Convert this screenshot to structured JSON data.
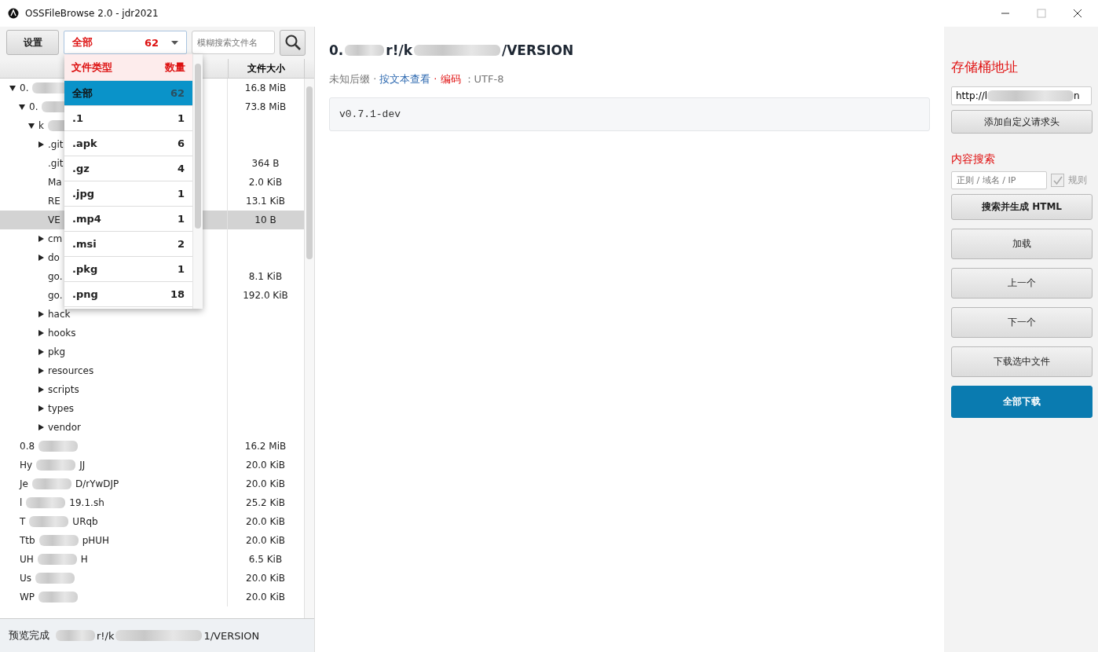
{
  "window": {
    "title": "OSSFileBrowse 2.0 - jdr2021"
  },
  "toolbar": {
    "settings_button": "设置",
    "type_select": {
      "label": "全部",
      "count": "62",
      "expanded": true
    },
    "search": {
      "placeholder": "模糊搜索文件名"
    }
  },
  "type_menu": {
    "header": {
      "type": "文件类型",
      "count": "数量"
    },
    "options": [
      {
        "label": "全部",
        "count": "62",
        "selected": true
      },
      {
        "label": ".1",
        "count": "1",
        "selected": false
      },
      {
        "label": ".apk",
        "count": "6",
        "selected": false
      },
      {
        "label": ".gz",
        "count": "4",
        "selected": false
      },
      {
        "label": ".jpg",
        "count": "1",
        "selected": false
      },
      {
        "label": ".mp4",
        "count": "1",
        "selected": false
      },
      {
        "label": ".msi",
        "count": "2",
        "selected": false
      },
      {
        "label": ".pkg",
        "count": "1",
        "selected": false
      },
      {
        "label": ".png",
        "count": "18",
        "selected": false
      }
    ]
  },
  "table": {
    "columns": [
      "文件大小"
    ],
    "rows": [
      {
        "parts": [
          "0."
        ],
        "redacted": true,
        "expanded": true,
        "size": "16.8 MiB",
        "selected": false,
        "children": [
          {
            "parts": [
              "0."
            ],
            "redacted": true,
            "expanded": true,
            "size": "73.8 MiB",
            "selected": false,
            "children": [
              {
                "parts": [
                  "k"
                ],
                "redacted": true,
                "expanded": true,
                "selected": false,
                "children": [
                  {
                    "parts": [
                      ".git"
                    ],
                    "expanded": false,
                    "selected": false
                  },
                  {
                    "parts": [
                      ".git"
                    ],
                    "size": "364 B",
                    "selected": false
                  },
                  {
                    "parts": [
                      "Ma"
                    ],
                    "size": "2.0 KiB",
                    "selected": false
                  },
                  {
                    "parts": [
                      "RE"
                    ],
                    "size": "13.1 KiB",
                    "selected": false
                  },
                  {
                    "parts": [
                      "VE"
                    ],
                    "size": "10 B",
                    "selected": true
                  },
                  {
                    "parts": [
                      "cm"
                    ],
                    "expanded": false,
                    "selected": false
                  },
                  {
                    "parts": [
                      "do"
                    ],
                    "expanded": false,
                    "selected": false
                  },
                  {
                    "parts": [
                      "go."
                    ],
                    "size": "8.1 KiB",
                    "selected": false
                  },
                  {
                    "parts": [
                      "go."
                    ],
                    "size": "192.0 KiB",
                    "selected": false
                  },
                  {
                    "parts": [
                      "hack"
                    ],
                    "redacted": false,
                    "expanded": false,
                    "selected": false
                  },
                  {
                    "parts": [
                      "hooks"
                    ],
                    "redacted": false,
                    "expanded": false,
                    "selected": false
                  },
                  {
                    "parts": [
                      "pkg"
                    ],
                    "redacted": false,
                    "expanded": false,
                    "selected": false
                  },
                  {
                    "parts": [
                      "resources"
                    ],
                    "redacted": false,
                    "expanded": false,
                    "selected": false
                  },
                  {
                    "parts": [
                      "scripts"
                    ],
                    "redacted": false,
                    "expanded": false,
                    "selected": false
                  },
                  {
                    "parts": [
                      "types"
                    ],
                    "redacted": false,
                    "expanded": false,
                    "selected": false
                  },
                  {
                    "parts": [
                      "vendor"
                    ],
                    "redacted": false,
                    "expanded": false,
                    "selected": false
                  }
                ]
              }
            ]
          }
        ]
      },
      {
        "parts": [
          "0.8"
        ],
        "redacted": true,
        "size": "16.2 MiB",
        "selected": false
      },
      {
        "parts": [
          "Hy",
          "JJ"
        ],
        "redacted": true,
        "size": "20.0 KiB",
        "selected": false
      },
      {
        "parts": [
          "Je",
          "D/rYwDJP"
        ],
        "redacted": true,
        "size": "20.0 KiB",
        "selected": false
      },
      {
        "parts": [
          "l",
          "19.1.sh"
        ],
        "redacted": true,
        "size": "25.2 KiB",
        "selected": false
      },
      {
        "parts": [
          "T",
          "URqb"
        ],
        "redacted": true,
        "size": "20.0 KiB",
        "selected": false
      },
      {
        "parts": [
          "Ttb",
          "pHUH"
        ],
        "redacted": true,
        "size": "20.0 KiB",
        "selected": false
      },
      {
        "parts": [
          "UH",
          "H"
        ],
        "redacted": true,
        "size": "6.5 KiB",
        "selected": false
      },
      {
        "parts": [
          "Us"
        ],
        "redacted": true,
        "size": "20.0 KiB",
        "selected": false
      },
      {
        "parts": [
          "WP"
        ],
        "redacted": true,
        "size": "20.0 KiB",
        "selected": false
      }
    ]
  },
  "status_bar": {
    "label": "预览完成",
    "path_parts": [
      "r!/k",
      "1/VERSION"
    ],
    "redacted": true
  },
  "preview": {
    "title_parts": [
      "0.",
      "r!/k",
      "/VERSION"
    ],
    "redacted": true,
    "meta": {
      "suffix": "未知后缀 ·",
      "view_mode": "按文本查看",
      "encoding_label": "· 编码",
      "encoding": "：UTF-8"
    },
    "content": "v0.7.1-dev"
  },
  "sidebar": {
    "bucket_heading": "存储桶地址",
    "bucket_url_parts": [
      "http://l",
      "n"
    ],
    "bucket_url_redacted": true,
    "add_header_button": "添加自定义请求头",
    "search_heading": "内容搜索",
    "search_placeholder": "正则 / 域名 / IP",
    "regex": {
      "label": "规则",
      "checked": true,
      "disabled": true
    },
    "buttons": [
      {
        "label": "搜索并生成 HTML",
        "kind": "bold"
      },
      {
        "label": "加载",
        "kind": "tall"
      },
      {
        "label": "上一个",
        "kind": "tall"
      },
      {
        "label": "下一个",
        "kind": "tall"
      },
      {
        "label": "下载选中文件",
        "kind": "tall"
      },
      {
        "label": "全部下载",
        "kind": "primary"
      }
    ]
  }
}
